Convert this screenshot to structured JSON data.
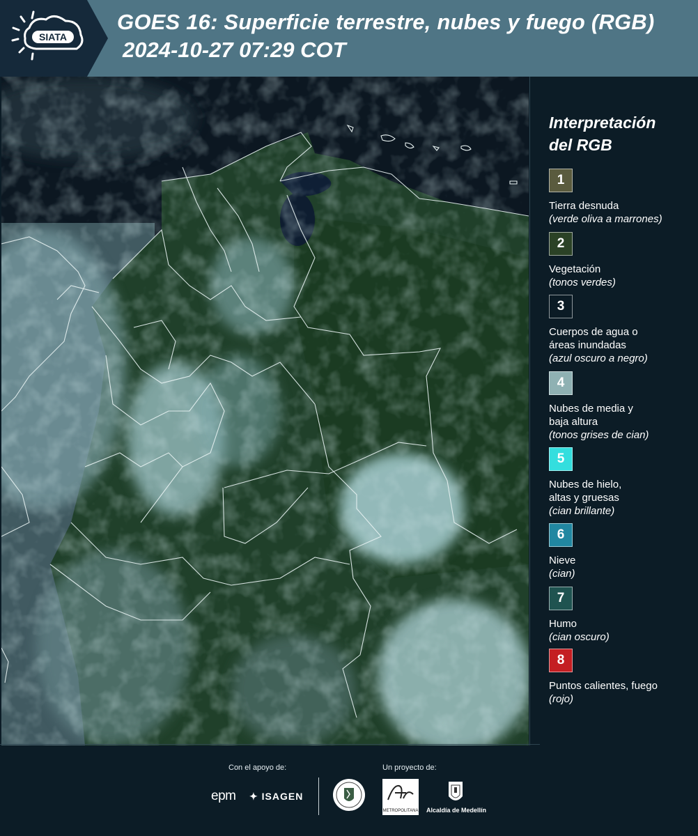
{
  "header": {
    "logo_text": "SIATA",
    "title_line1": "GOES 16: Superficie terrestre, nubes y fuego (RGB)",
    "title_line2": "2024-10-27 07:29 COT"
  },
  "map": {
    "description_icon": "satellite-rgb-composite",
    "land_color": "#1d3a25",
    "cloud_color": "#9fc7cb",
    "water_color": "#0d1a2a",
    "border_color": "#e8f2f2"
  },
  "legend": {
    "title_line1": "Interpretación",
    "title_line2": "del RGB",
    "items": [
      {
        "number": "1",
        "label_lines": [
          "Tierra desnuda"
        ],
        "sub": "(verde oliva a marrones)",
        "color": "#5a5b3e"
      },
      {
        "number": "2",
        "label_lines": [
          "Vegetación"
        ],
        "sub": "(tonos verdes)",
        "color": "#2b4226"
      },
      {
        "number": "3",
        "label_lines": [
          "Cuerpos de agua o",
          "áreas inundadas"
        ],
        "sub": "(azul oscuro a negro)",
        "color": "#0b1b25"
      },
      {
        "number": "4",
        "label_lines": [
          "Nubes de media y",
          "baja altura"
        ],
        "sub": "(tonos grises de cian)",
        "color": "#8fb1b3"
      },
      {
        "number": "5",
        "label_lines": [
          "Nubes de hielo,",
          "altas y gruesas"
        ],
        "sub": "(cian brillante)",
        "color": "#34dede"
      },
      {
        "number": "6",
        "label_lines": [
          "Nieve"
        ],
        "sub": "(cian)",
        "color": "#2187a1"
      },
      {
        "number": "7",
        "label_lines": [
          "Humo"
        ],
        "sub": "(cian oscuro)",
        "color": "#1f5350"
      },
      {
        "number": "8",
        "label_lines": [
          "Puntos calientes, fuego"
        ],
        "sub": "(rojo)",
        "color": "#c41e22"
      }
    ]
  },
  "footer": {
    "support_caption": "Con el apoyo de:",
    "project_caption": "Un proyecto de:",
    "epm": "epm",
    "isagen": "ISAGEN",
    "area_text": "METROPOLITANA",
    "alcaldia": "Alcaldía de Medellín"
  }
}
